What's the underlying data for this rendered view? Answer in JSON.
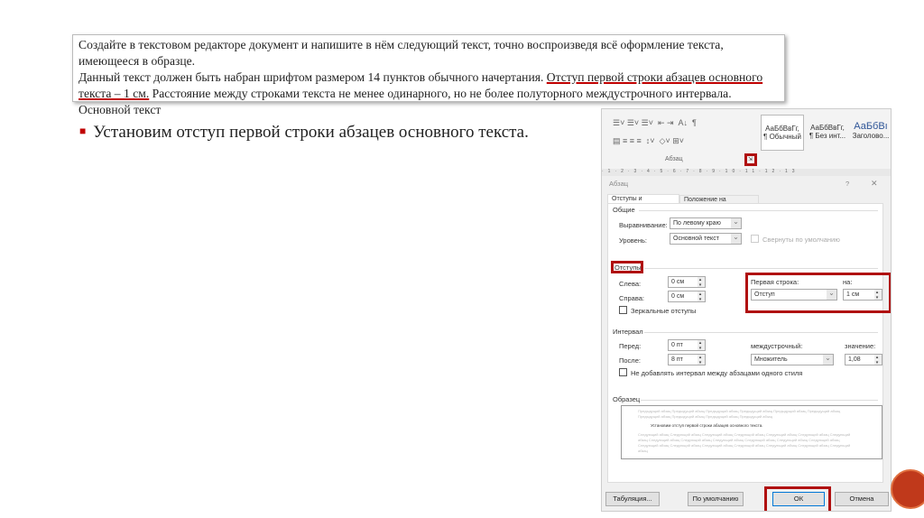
{
  "task": {
    "line1": "Создайте в текстовом редакторе документ и напишите в нём следующий текст, точно воспроизведя всё оформление текста, имеющееся в образце.",
    "line2a": "Данный текст должен быть набран шрифтом размером 14 пунктов обычного начертания.",
    "line2b": "Отступ первой строки абзацев основного текста – 1 см.",
    "line2c": "Расстояние между строками текста не менее одинарного, но не более полуторного междустрочного интервала. Основной текст"
  },
  "bullet": "Установим отступ первой строки абзацев основного текста.",
  "ribbon": {
    "group": "Абзац",
    "styles": [
      {
        "preview": "АаБбВвГг,",
        "name": "¶ Обычный"
      },
      {
        "preview": "АаБбВвГг,",
        "name": "¶ Без инт..."
      },
      {
        "preview": "АаБбВı",
        "name": "Заголово..."
      }
    ]
  },
  "ruler": "·1·2·3·4·5·6·7·8·9·10·11·12·13",
  "dialog": {
    "title": "Абзац",
    "help": "?",
    "close": "✕",
    "tabs": [
      "Отступы и интервалы",
      "Положение на странице"
    ],
    "general": "Общие",
    "align_label": "Выравнивание:",
    "align_value": "По левому краю",
    "level_label": "Уровень:",
    "level_value": "Основной текст",
    "collapsed": "Свернуты по умолчанию",
    "indents": "Отступы",
    "left_label": "Слева:",
    "left_value": "0 см",
    "right_label": "Справа:",
    "right_value": "0 см",
    "first_label": "Первая строка:",
    "first_value": "Отступ",
    "by_label": "на:",
    "by_value": "1 см",
    "mirror": "Зеркальные отступы",
    "spacing": "Интервал",
    "before_label": "Перед:",
    "before_value": "0 пт",
    "after_label": "После:",
    "after_value": "8 пт",
    "line_label": "междустрочный:",
    "line_value": "Множитель",
    "value_label": "значение:",
    "value_value": "1,08",
    "no_space": "Не добавлять интервал между абзацами одного стиля",
    "sample": "Образец",
    "sample_prev": "Предыдущий абзац Предыдущий абзац Предыдущий абзац Предыдущий абзац Предыдущий абзац Предыдущий абзац Предыдущий абзац Предыдущий абзац Предыдущий абзац Предыдущий абзац",
    "sample_text": "Установим отступ первой строки абзацев основного текста.",
    "sample_next": "Следующий абзац Следующий абзац Следующий абзац Следующий абзац Следующий абзац Следующий абзац Следующий абзац Следующий абзац Следующий абзац Следующий абзац Следующий абзац Следующий абзац Следующий абзац Следующий абзац Следующий абзац Следующий абзац Следующий абзац Следующий абзац Следующий абзац Следующий абзац",
    "tabs_btn": "Табуляция...",
    "default_btn": "По умолчанию",
    "ok": "ОК",
    "cancel": "Отмена"
  }
}
